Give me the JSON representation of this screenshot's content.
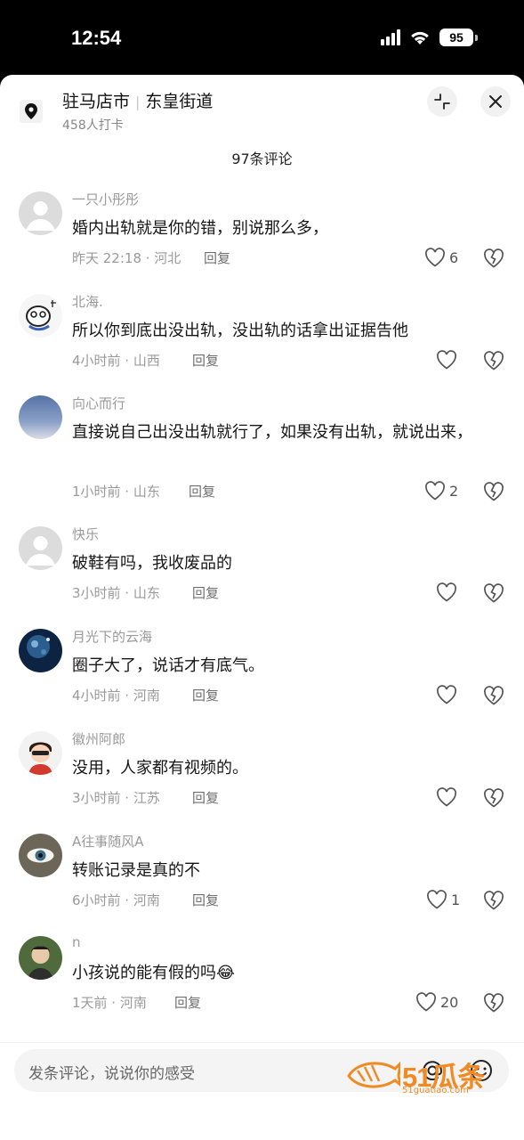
{
  "status_bar": {
    "time": "12:54",
    "battery": "95"
  },
  "location": {
    "city": "驻马店市",
    "street": "东皇街道",
    "checkins": "458人打卡"
  },
  "comment_count": "97条评论",
  "reply_label": "回复",
  "comments": [
    {
      "user": "一只小彤彤",
      "text": "婚内出轨就是你的错，别说那么多，",
      "meta": "昨天 22:18 · 河北",
      "likes": "6"
    },
    {
      "user": "北海.",
      "text": "所以你到底出没出轨，没出轨的话拿出证据告他",
      "meta": "4小时前 · 山西",
      "likes": ""
    },
    {
      "user": "向心而行",
      "text": "直接说自己出没出轨就行了，如果没有出轨，就说出来，",
      "meta": "1小时前 · 山东",
      "likes": "2"
    },
    {
      "user": "快乐",
      "text": "破鞋有吗，我收废品的",
      "meta": "3小时前 · 山东",
      "likes": ""
    },
    {
      "user": "月光下的云海",
      "text": "圈子大了，说话才有底气。",
      "meta": "4小时前 · 河南",
      "likes": ""
    },
    {
      "user": "徽州阿郎",
      "text": "没用，人家都有视频的。",
      "meta": "3小时前 · 江苏",
      "likes": ""
    },
    {
      "user": "A往事随风A",
      "text": "转账记录是真的不",
      "meta": "6小时前 · 河南",
      "likes": "1"
    },
    {
      "user": "n",
      "text": "小孩说的能有假的吗",
      "emoji": "😂",
      "meta": "1天前 · 河南",
      "likes": "20"
    }
  ],
  "input": {
    "placeholder": "发条评论，说说你的感受"
  },
  "watermark": {
    "text": "51瓜条",
    "url": "51guatiao.com"
  },
  "icons": {
    "location": "location-pin-icon",
    "collapse": "collapse-icon",
    "close": "close-icon",
    "like": "heart-outline-icon",
    "dislike": "broken-heart-icon",
    "at": "at-sign-icon",
    "emoji": "smiley-icon"
  },
  "colors": {
    "accent_watermark": "#f08a23",
    "meta_gray": "#9a9a9a"
  }
}
